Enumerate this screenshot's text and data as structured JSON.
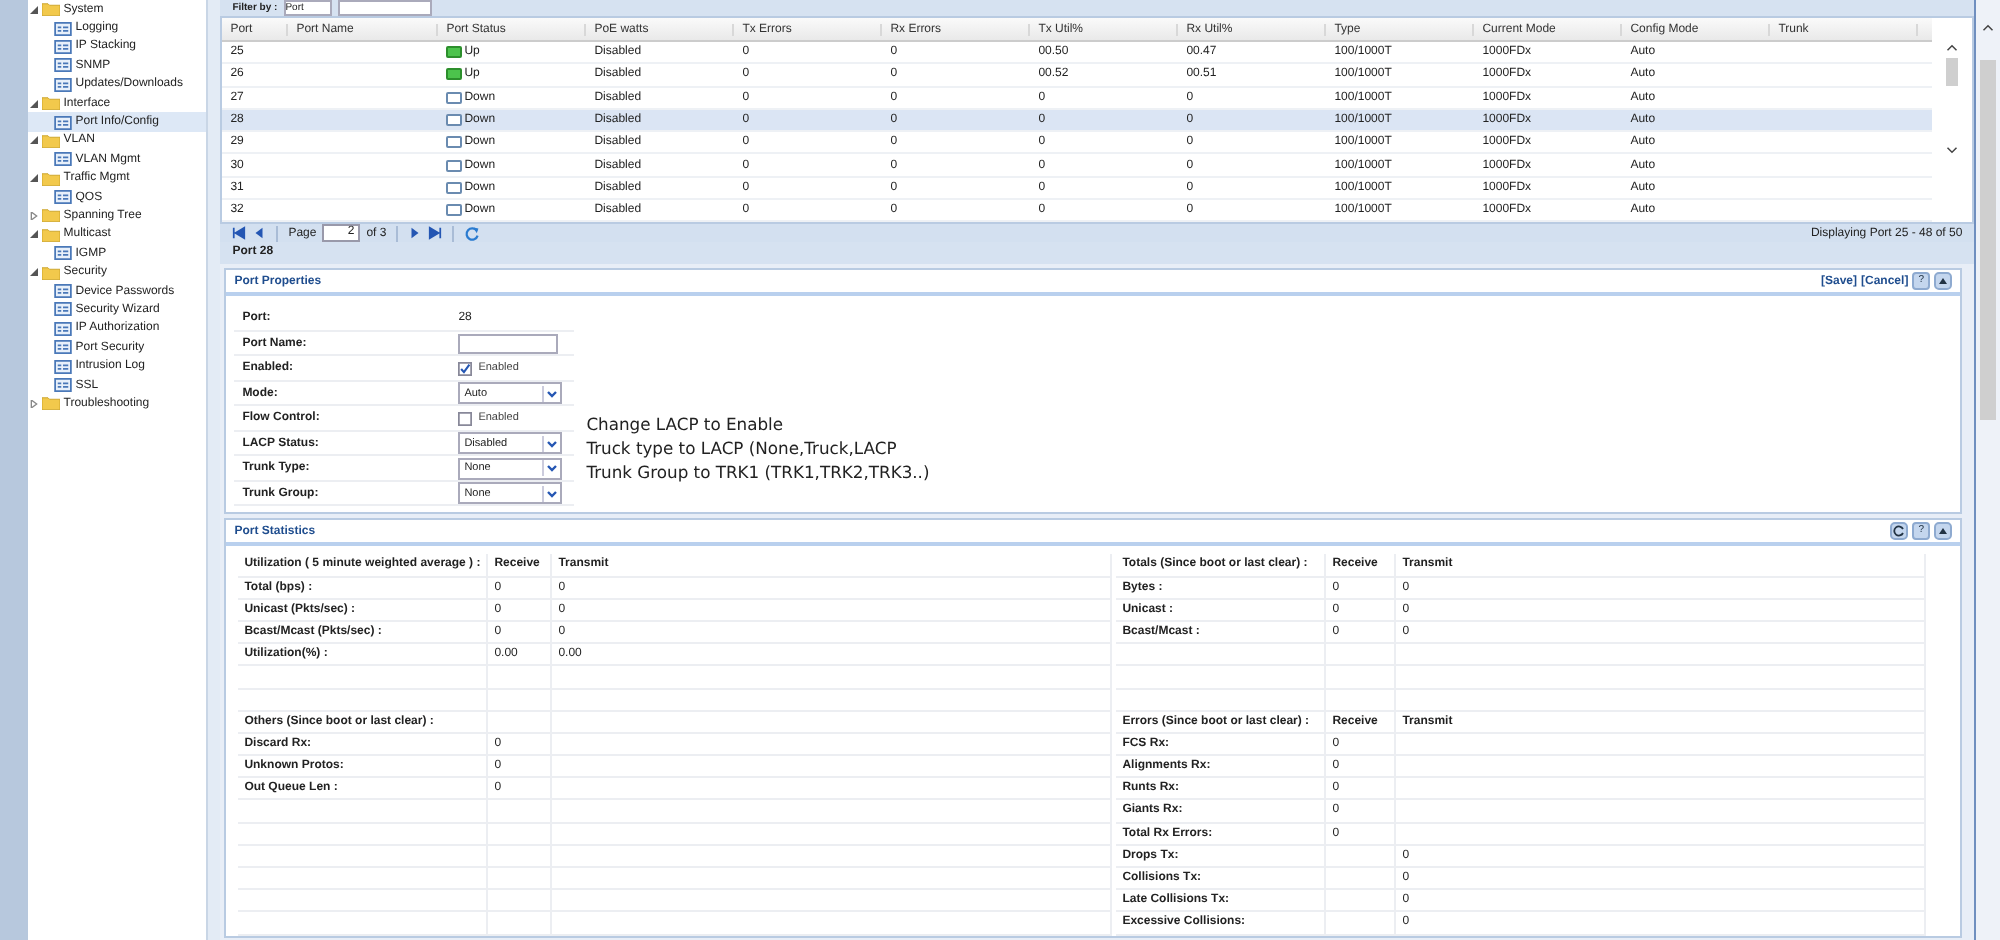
{
  "sidebar": {
    "items": [
      {
        "label": "System",
        "expanded": true,
        "selected": false,
        "children": [
          {
            "label": "Logging",
            "selected": false
          },
          {
            "label": "IP Stacking",
            "selected": false
          },
          {
            "label": "SNMP",
            "selected": false
          },
          {
            "label": "Updates/Downloads",
            "selected": false
          }
        ]
      },
      {
        "label": "Interface",
        "expanded": true,
        "selected": false,
        "children": [
          {
            "label": "Port Info/Config",
            "selected": true
          }
        ]
      },
      {
        "label": "VLAN",
        "expanded": true,
        "selected": false,
        "children": [
          {
            "label": "VLAN Mgmt",
            "selected": false
          }
        ]
      },
      {
        "label": "Traffic Mgmt",
        "expanded": true,
        "selected": false,
        "children": [
          {
            "label": "QOS",
            "selected": false
          }
        ]
      },
      {
        "label": "Spanning Tree",
        "expanded": false,
        "selected": false
      },
      {
        "label": "Multicast",
        "expanded": true,
        "selected": false,
        "children": [
          {
            "label": "IGMP",
            "selected": false
          }
        ]
      },
      {
        "label": "Security",
        "expanded": true,
        "selected": false,
        "children": [
          {
            "label": "Device Passwords",
            "selected": false
          },
          {
            "label": "Security Wizard",
            "selected": false
          },
          {
            "label": "IP Authorization",
            "selected": false
          },
          {
            "label": "Port Security",
            "selected": false
          },
          {
            "label": "Intrusion Log",
            "selected": false
          },
          {
            "label": "SSL",
            "selected": false
          }
        ]
      },
      {
        "label": "Troubleshooting",
        "expanded": false,
        "selected": false
      }
    ]
  },
  "filter": {
    "label": "Filter by :",
    "value": "Port"
  },
  "table": {
    "columns": [
      "Port",
      "Port Name",
      "Port Status",
      "PoE watts",
      "Tx Errors",
      "Rx Errors",
      "Tx Util%",
      "Rx Util%",
      "Type",
      "Current Mode",
      "Config Mode",
      "Trunk"
    ],
    "rows": [
      {
        "port": "25",
        "status": "Up",
        "link_up": true,
        "poe": "Disabled",
        "tx_errors": "0",
        "rx_errors": "0",
        "tx_util": "00.50",
        "rx_util": "00.47",
        "type": "100/1000T",
        "current_mode": "1000FDx",
        "config_mode": "Auto",
        "selected": false
      },
      {
        "port": "26",
        "status": "Up",
        "link_up": true,
        "poe": "Disabled",
        "tx_errors": "0",
        "rx_errors": "0",
        "tx_util": "00.52",
        "rx_util": "00.51",
        "type": "100/1000T",
        "current_mode": "1000FDx",
        "config_mode": "Auto",
        "selected": false
      },
      {
        "port": "27",
        "status": "Down",
        "link_up": false,
        "poe": "Disabled",
        "tx_errors": "0",
        "rx_errors": "0",
        "tx_util": "0",
        "rx_util": "0",
        "type": "100/1000T",
        "current_mode": "1000FDx",
        "config_mode": "Auto",
        "selected": false
      },
      {
        "port": "28",
        "status": "Down",
        "link_up": false,
        "poe": "Disabled",
        "tx_errors": "0",
        "rx_errors": "0",
        "tx_util": "0",
        "rx_util": "0",
        "type": "100/1000T",
        "current_mode": "1000FDx",
        "config_mode": "Auto",
        "selected": true
      },
      {
        "port": "29",
        "status": "Down",
        "link_up": false,
        "poe": "Disabled",
        "tx_errors": "0",
        "rx_errors": "0",
        "tx_util": "0",
        "rx_util": "0",
        "type": "100/1000T",
        "current_mode": "1000FDx",
        "config_mode": "Auto",
        "selected": false
      },
      {
        "port": "30",
        "status": "Down",
        "link_up": false,
        "poe": "Disabled",
        "tx_errors": "0",
        "rx_errors": "0",
        "tx_util": "0",
        "rx_util": "0",
        "type": "100/1000T",
        "current_mode": "1000FDx",
        "config_mode": "Auto",
        "selected": false
      },
      {
        "port": "31",
        "status": "Down",
        "link_up": false,
        "poe": "Disabled",
        "tx_errors": "0",
        "rx_errors": "0",
        "tx_util": "0",
        "rx_util": "0",
        "type": "100/1000T",
        "current_mode": "1000FDx",
        "config_mode": "Auto",
        "selected": false
      },
      {
        "port": "32",
        "status": "Down",
        "link_up": false,
        "poe": "Disabled",
        "tx_errors": "0",
        "rx_errors": "0",
        "tx_util": "0",
        "rx_util": "0",
        "type": "100/1000T",
        "current_mode": "1000FDx",
        "config_mode": "Auto",
        "selected": false
      }
    ]
  },
  "pager": {
    "page_label": "Page",
    "page": "2",
    "of": "of 3",
    "summary": "Displaying Port 25 - 48 of 50"
  },
  "port_bar": {
    "title": "Port 28"
  },
  "port_properties": {
    "title": "Port Properties",
    "actions": [
      "[Save]",
      "[Cancel]"
    ],
    "help": "?",
    "fields": [
      {
        "kind": "text",
        "label": "Port:",
        "value": "28"
      },
      {
        "kind": "input",
        "label": "Port Name:"
      },
      {
        "kind": "checkbox",
        "label": "Enabled:",
        "option": "Enabled",
        "checked": true
      },
      {
        "kind": "select",
        "label": "Mode:",
        "value": "Auto"
      },
      {
        "kind": "checkbox",
        "label": "Flow Control:",
        "option": "Enabled",
        "checked": false
      },
      {
        "kind": "select",
        "label": "LACP Status:",
        "value": "Disabled"
      },
      {
        "kind": "select",
        "label": "Trunk Type:",
        "value": "None"
      },
      {
        "kind": "select",
        "label": "Trunk Group:",
        "value": "None"
      }
    ],
    "note": [
      "Change LACP to Enable",
      "Truck type to LACP (None,Truck,LACP",
      "Trunk Group to TRK1 (TRK1,TRK2,TRK3..)"
    ]
  },
  "port_statistics": {
    "title": "Port Statistics",
    "help": "?",
    "left": [
      {
        "kind": "header",
        "label": "Utilization ( 5 minute weighted average ) :",
        "receive": "Receive",
        "transmit": "Transmit"
      },
      {
        "kind": "row",
        "label": "Total (bps) :",
        "receive": "0",
        "transmit": "0"
      },
      {
        "kind": "row",
        "label": "Unicast (Pkts/sec) :",
        "receive": "0",
        "transmit": "0"
      },
      {
        "kind": "row",
        "label": "Bcast/Mcast (Pkts/sec) :",
        "receive": "0",
        "transmit": "0"
      },
      {
        "kind": "row",
        "label": "Utilization(%) :",
        "receive": "0.00",
        "transmit": "0.00"
      },
      {
        "kind": "blank"
      },
      {
        "kind": "blank"
      },
      {
        "kind": "header",
        "label": "Others (Since boot or last clear) :"
      },
      {
        "kind": "row",
        "label": "Discard Rx:",
        "receive": "0"
      },
      {
        "kind": "row",
        "label": "Unknown Protos:",
        "receive": "0"
      },
      {
        "kind": "row",
        "label": "Out Queue Len :",
        "receive": "0"
      },
      {
        "kind": "blank"
      },
      {
        "kind": "blank"
      },
      {
        "kind": "blank"
      },
      {
        "kind": "blank"
      },
      {
        "kind": "blank"
      },
      {
        "kind": "blank"
      }
    ],
    "right": [
      {
        "kind": "header",
        "label": "Totals (Since boot or last clear) :",
        "receive": "Receive",
        "transmit": "Transmit"
      },
      {
        "kind": "row",
        "label": "Bytes :",
        "receive": "0",
        "transmit": "0"
      },
      {
        "kind": "row",
        "label": "Unicast :",
        "receive": "0",
        "transmit": "0"
      },
      {
        "kind": "row",
        "label": "Bcast/Mcast :",
        "receive": "0",
        "transmit": "0"
      },
      {
        "kind": "blank"
      },
      {
        "kind": "blank"
      },
      {
        "kind": "blank"
      },
      {
        "kind": "header",
        "label": "Errors (Since boot or last clear) :",
        "receive": "Receive",
        "transmit": "Transmit"
      },
      {
        "kind": "row",
        "label": "FCS Rx:",
        "receive": "0"
      },
      {
        "kind": "row",
        "label": "Alignments Rx:",
        "receive": "0"
      },
      {
        "kind": "row",
        "label": "Runts Rx:",
        "receive": "0"
      },
      {
        "kind": "row",
        "label": "Giants Rx:",
        "receive": "0"
      },
      {
        "kind": "row",
        "label": "Total Rx Errors:",
        "receive": "0"
      },
      {
        "kind": "row",
        "label": "Drops Tx:",
        "transmit": "0"
      },
      {
        "kind": "row",
        "label": "Collisions Tx:",
        "transmit": "0"
      },
      {
        "kind": "row",
        "label": "Late Collisions Tx:",
        "transmit": "0"
      },
      {
        "kind": "row",
        "label": "Excessive Collisions:",
        "transmit": "0"
      }
    ]
  }
}
